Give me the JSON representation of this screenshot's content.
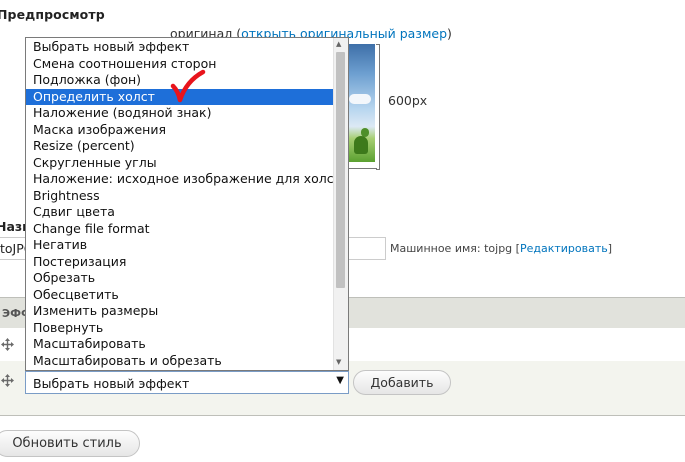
{
  "preview": {
    "heading": "Предпросмотр",
    "caption_prefix": "оригинал (",
    "caption_link": "открыть оригинальный размер",
    "caption_suffix": ")",
    "height_label": "600px"
  },
  "name_field": {
    "label": "Название",
    "value": "toJPG",
    "machine_name_prefix": "Машинное имя: tojpg [",
    "machine_name_link": "Редактировать",
    "machine_name_suffix": "]"
  },
  "effects_table": {
    "header": "Эффект"
  },
  "new_effect": {
    "selected": "Выбрать новый эффект",
    "options": [
      "Выбрать новый эффект",
      "Смена соотношения сторон",
      "Подложка (фон)",
      "Определить холст",
      "Наложение (водяной знак)",
      "Маска изображения",
      "Resize (percent)",
      "Скругленные углы",
      "Наложение: исходное изображение для холста",
      "Brightness",
      "Сдвиг цвета",
      "Change file format",
      "Негатив",
      "Постеризация",
      "Обрезать",
      "Обесцветить",
      "Изменить размеры",
      "Повернуть",
      "Масштабировать",
      "Масштабировать и обрезать"
    ],
    "highlighted": "Определить холст",
    "add_button": "Добавить"
  },
  "update_button": "Обновить стиль",
  "colors": {
    "link": "#0074bd",
    "highlight": "#1e6fd9",
    "check_mark": "#e8141c"
  }
}
